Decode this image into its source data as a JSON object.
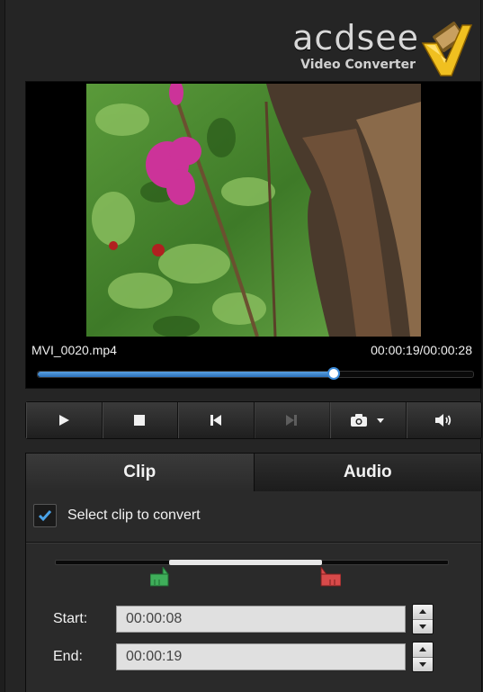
{
  "logo": {
    "brand": "acdsee",
    "product": "Video Converter"
  },
  "player": {
    "file_name": "MVI_0020.mp4",
    "time_readout": "00:00:19/00:00:28",
    "progress_fraction": 0.68
  },
  "controls": [
    {
      "name": "play-button",
      "icon": "play-icon",
      "enabled": true
    },
    {
      "name": "stop-button",
      "icon": "stop-icon",
      "enabled": true
    },
    {
      "name": "previous-frame-button",
      "icon": "skip-back-icon",
      "enabled": true
    },
    {
      "name": "next-frame-button",
      "icon": "skip-forward-icon",
      "enabled": false
    },
    {
      "name": "snapshot-button",
      "icon": "camera-icon",
      "enabled": true
    },
    {
      "name": "volume-button",
      "icon": "speaker-icon",
      "enabled": true
    }
  ],
  "tabs": {
    "clip": "Clip",
    "audio": "Audio",
    "active": "clip"
  },
  "clip": {
    "select_label": "Select clip to convert",
    "selected": true,
    "range_start_fraction": 0.29,
    "range_end_fraction": 0.68,
    "start_label": "Start:",
    "start_value": "00:00:08",
    "end_label": "End:",
    "end_value": "00:00:19"
  },
  "colors": {
    "accent_blue": "#3b8ad8",
    "start_marker": "#3fae5a",
    "end_marker": "#d84a4a",
    "checkmark": "#4aa3e8"
  }
}
